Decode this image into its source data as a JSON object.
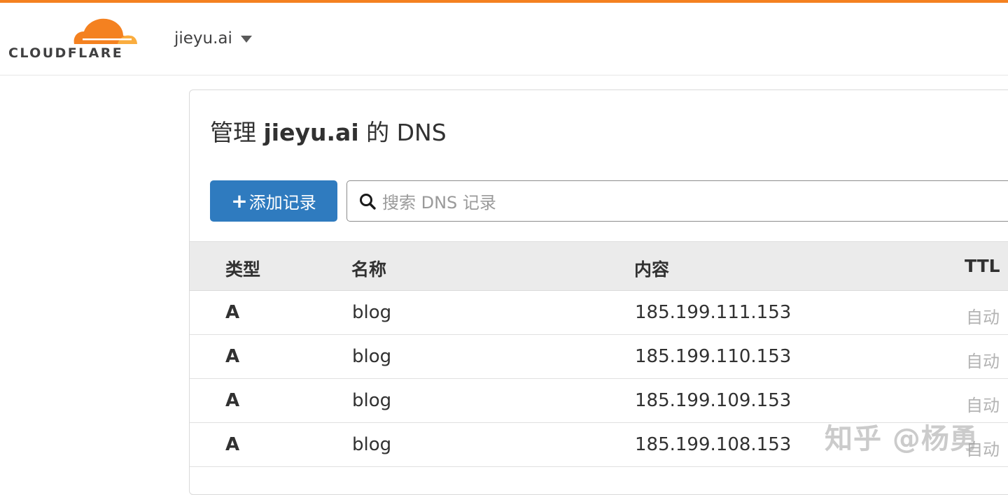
{
  "header": {
    "logo_text": "CLOUDFLARE",
    "domain": "jieyu.ai",
    "accent_color": "#f48120"
  },
  "dns": {
    "title_prefix": "管理",
    "title_domain": "jieyu.ai",
    "title_suffix": "的 DNS",
    "add_button_plus": "+",
    "add_button_label": "添加记录",
    "search_placeholder": "搜索 DNS 记录",
    "button_color": "#2f7bbf",
    "columns": [
      "类型",
      "名称",
      "内容",
      "TTL"
    ],
    "records": [
      {
        "type": "A",
        "name": "blog",
        "content": "185.199.111.153",
        "ttl": "自动"
      },
      {
        "type": "A",
        "name": "blog",
        "content": "185.199.110.153",
        "ttl": "自动"
      },
      {
        "type": "A",
        "name": "blog",
        "content": "185.199.109.153",
        "ttl": "自动"
      },
      {
        "type": "A",
        "name": "blog",
        "content": "185.199.108.153",
        "ttl": "自动"
      }
    ]
  },
  "watermark": "知乎 @杨勇",
  "icons": {
    "search": "search-icon",
    "logo": "cloud-logo-icon",
    "dropdown": "chevron-down-icon"
  }
}
